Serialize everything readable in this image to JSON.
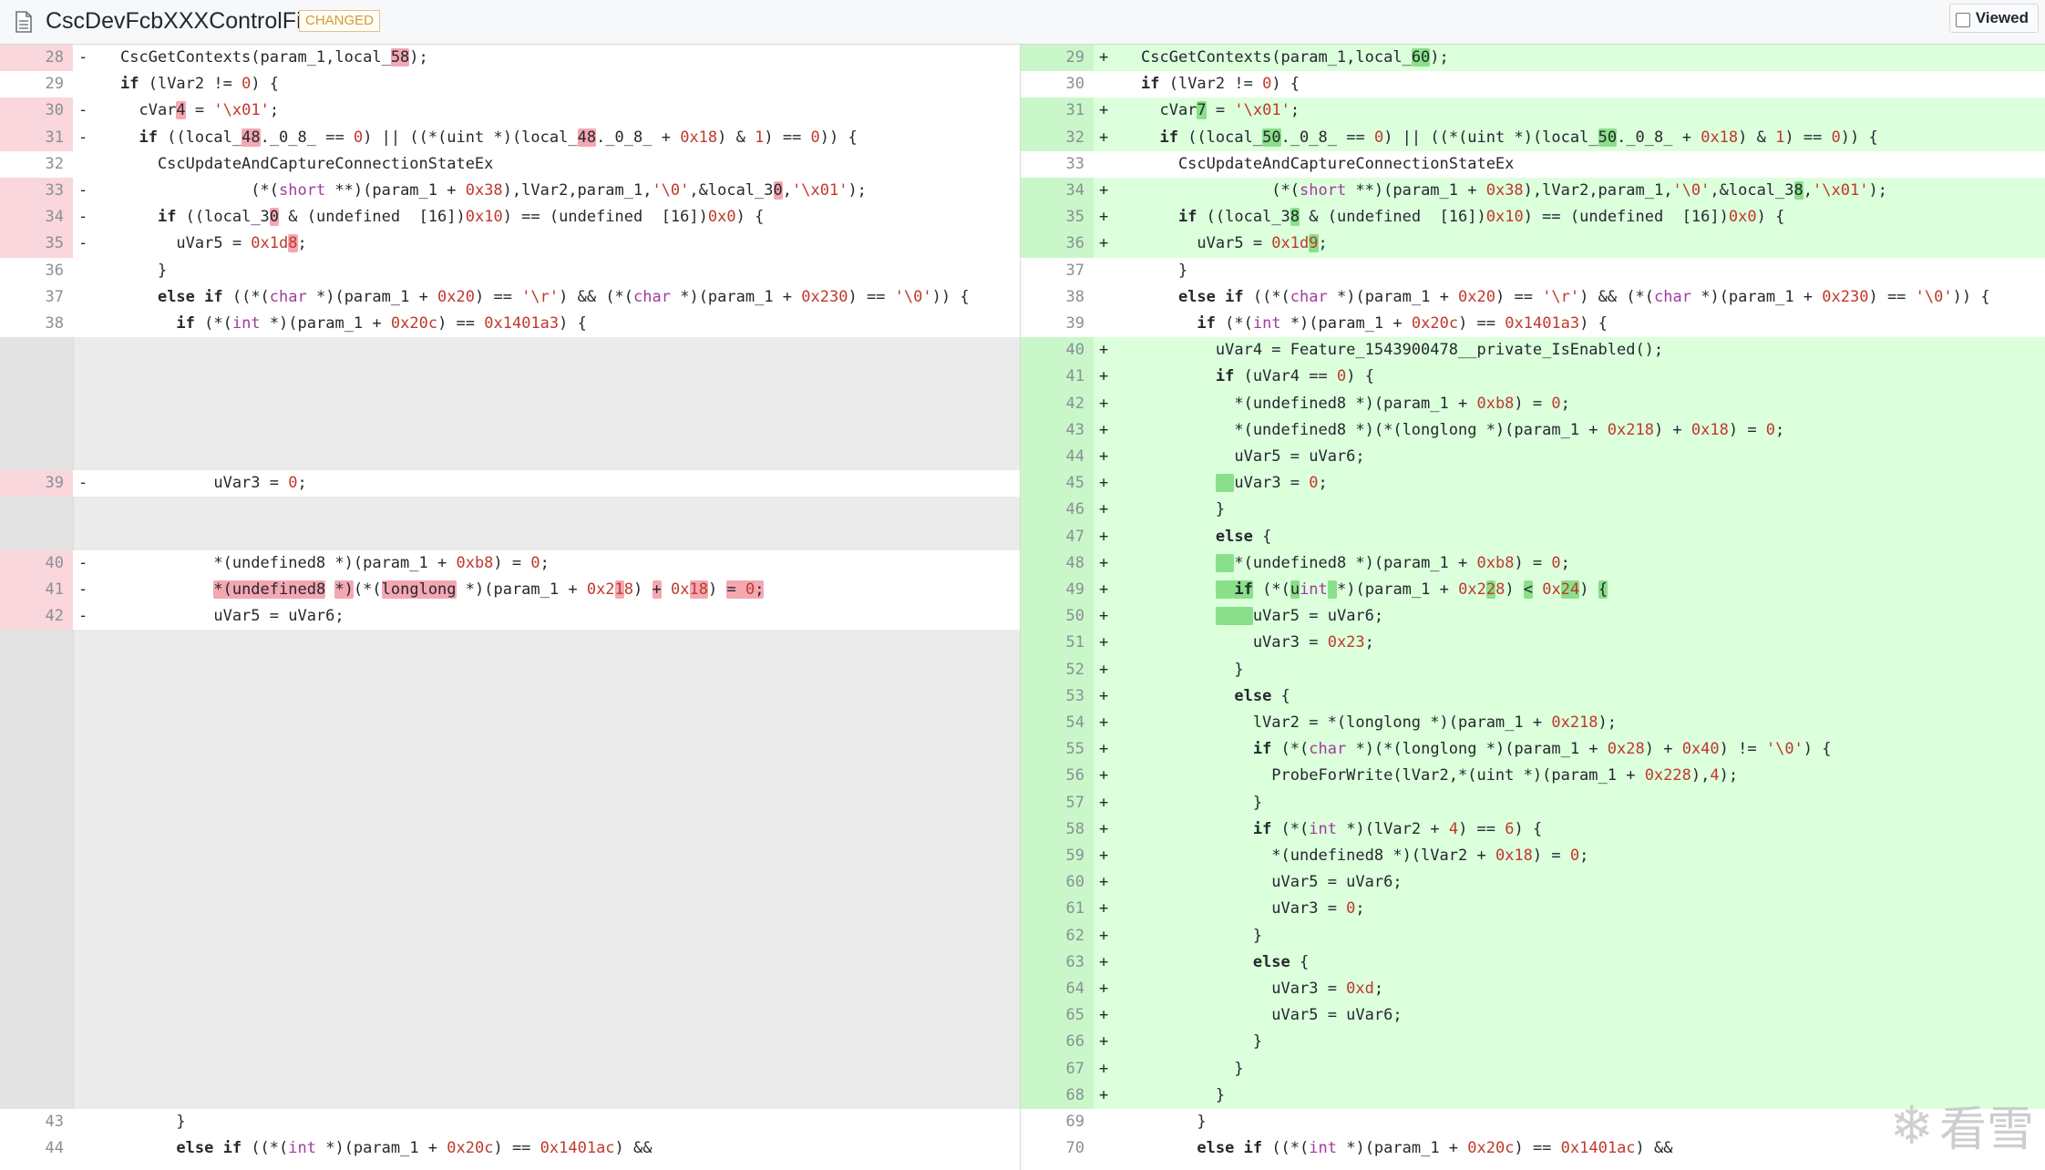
{
  "header": {
    "file_name": "CscDevFcbXXXControlFile",
    "badge": "CHANGED",
    "viewed_label": "Viewed",
    "viewed_checked": false
  },
  "watermark": {
    "text": "看雪",
    "icon": "snowflake-icon"
  },
  "colors": {
    "deleted_gutter": "#f9d7dc",
    "deleted_highlight": "#f5a7b2",
    "added_gutter": "#c9f7c9",
    "added_background": "#dcffdc",
    "added_highlight": "#8ae08a",
    "empty_background": "#ebebeb"
  },
  "left": [
    {
      "n": "28",
      "sign": "-",
      "type": "del",
      "html": "CscGetContexts(param_1,local_<span class='hd'>58</span>);"
    },
    {
      "n": "29",
      "sign": "",
      "type": "ctx",
      "html": "<span class='k'>if</span> (lVar2 != <span class='h'>0</span>) {"
    },
    {
      "n": "30",
      "sign": "-",
      "type": "del",
      "html": "  cVar<span class='hd'>4</span> = <span class='s'>'\\x01'</span>;"
    },
    {
      "n": "31",
      "sign": "-",
      "type": "del",
      "html": "  <span class='k'>if</span> ((local_<span class='hd'>48</span>._0_8_ == <span class='h'>0</span>) || ((*(uint *)(local_<span class='hd'>48</span>._0_8_ + <span class='h'>0x18</span>) &amp; <span class='h'>1</span>) == <span class='h'>0</span>)) {"
    },
    {
      "n": "32",
      "sign": "",
      "type": "ctx",
      "html": "    CscUpdateAndCaptureConnectionStateEx"
    },
    {
      "n": "33",
      "sign": "-",
      "type": "del",
      "html": "              (*(<span class='t'>short</span> **)(param_1 + <span class='h'>0x38</span>),lVar2,param_1,<span class='s'>'\\0'</span>,&amp;local_3<span class='hd'>0</span>,<span class='s'>'\\x01'</span>);"
    },
    {
      "n": "34",
      "sign": "-",
      "type": "del",
      "html": "    <span class='k'>if</span> ((local_3<span class='hd'>0</span> &amp; (undefined  [16])<span class='h'>0x10</span>) == (undefined  [16])<span class='h'>0x0</span>) {"
    },
    {
      "n": "35",
      "sign": "-",
      "type": "del",
      "html": "      uVar5 = <span class='h'>0x1d<span class='hd'>8</span></span>;"
    },
    {
      "n": "36",
      "sign": "",
      "type": "ctx",
      "html": "    }"
    },
    {
      "n": "37",
      "sign": "",
      "type": "ctx",
      "html": "    <span class='k'>else if</span> ((*(<span class='t'>char</span> *)(param_1 + <span class='h'>0x20</span>) == <span class='s'>'\\r'</span>) &amp;&amp; (*(<span class='t'>char</span> *)(param_1 + <span class='h'>0x230</span>) == <span class='s'>'\\0'</span>)) {"
    },
    {
      "n": "38",
      "sign": "",
      "type": "ctx",
      "html": "      <span class='k'>if</span> (*(<span class='t'>int</span> *)(param_1 + <span class='h'>0x20c</span>) == <span class='h'>0x1401a3</span>) {"
    },
    {
      "n": "",
      "sign": "",
      "type": "empty",
      "html": ""
    },
    {
      "n": "",
      "sign": "",
      "type": "empty",
      "html": ""
    },
    {
      "n": "",
      "sign": "",
      "type": "empty",
      "html": ""
    },
    {
      "n": "",
      "sign": "",
      "type": "empty",
      "html": ""
    },
    {
      "n": "",
      "sign": "",
      "type": "empty",
      "html": ""
    },
    {
      "n": "39",
      "sign": "-",
      "type": "del",
      "html": "          uVar3 = <span class='h'>0</span>;"
    },
    {
      "n": "",
      "sign": "",
      "type": "empty",
      "html": ""
    },
    {
      "n": "",
      "sign": "",
      "type": "empty",
      "html": ""
    },
    {
      "n": "40",
      "sign": "-",
      "type": "del",
      "html": "          *(undefined8 *)(param_1 + <span class='h'>0xb8</span>) = <span class='h'>0</span>;"
    },
    {
      "n": "41",
      "sign": "-",
      "type": "del",
      "html": "          <span class='hd'>*(undefined8</span> <span class='hd'>*)</span>(*(<span class='hd'>longlong</span> *)(param_1 + <span class='h'>0x2<span class='hd'>1</span>8</span>) <span class='hd'>+</span> <span class='h'>0x<span class='hd'>18</span></span>) <span class='hd'>= <span class='h'>0</span>;</span>"
    },
    {
      "n": "42",
      "sign": "-",
      "type": "del",
      "html": "          uVar5 = uVar6;"
    },
    {
      "n": "",
      "sign": "",
      "type": "empty",
      "html": ""
    },
    {
      "n": "",
      "sign": "",
      "type": "empty",
      "html": ""
    },
    {
      "n": "",
      "sign": "",
      "type": "empty",
      "html": ""
    },
    {
      "n": "",
      "sign": "",
      "type": "empty",
      "html": ""
    },
    {
      "n": "",
      "sign": "",
      "type": "empty",
      "html": ""
    },
    {
      "n": "",
      "sign": "",
      "type": "empty",
      "html": ""
    },
    {
      "n": "",
      "sign": "",
      "type": "empty",
      "html": ""
    },
    {
      "n": "",
      "sign": "",
      "type": "empty",
      "html": ""
    },
    {
      "n": "",
      "sign": "",
      "type": "empty",
      "html": ""
    },
    {
      "n": "",
      "sign": "",
      "type": "empty",
      "html": ""
    },
    {
      "n": "",
      "sign": "",
      "type": "empty",
      "html": ""
    },
    {
      "n": "",
      "sign": "",
      "type": "empty",
      "html": ""
    },
    {
      "n": "",
      "sign": "",
      "type": "empty",
      "html": ""
    },
    {
      "n": "",
      "sign": "",
      "type": "empty",
      "html": ""
    },
    {
      "n": "",
      "sign": "",
      "type": "empty",
      "html": ""
    },
    {
      "n": "",
      "sign": "",
      "type": "empty",
      "html": ""
    },
    {
      "n": "",
      "sign": "",
      "type": "empty",
      "html": ""
    },
    {
      "n": "",
      "sign": "",
      "type": "empty",
      "html": ""
    },
    {
      "n": "43",
      "sign": "",
      "type": "ctx",
      "html": "      }"
    },
    {
      "n": "44",
      "sign": "",
      "type": "ctx",
      "html": "      <span class='k'>else if</span> ((*(<span class='t'>int</span> *)(param_1 + <span class='h'>0x20c</span>) == <span class='h'>0x1401ac</span>) &amp;&amp;"
    }
  ],
  "right": [
    {
      "n": "29",
      "sign": "+",
      "type": "add",
      "html": "CscGetContexts(param_1,local_<span class='ha'>60</span>);"
    },
    {
      "n": "30",
      "sign": "",
      "type": "ctx",
      "html": "<span class='k'>if</span> (lVar2 != <span class='h'>0</span>) {"
    },
    {
      "n": "31",
      "sign": "+",
      "type": "add",
      "html": "  cVar<span class='ha'>7</span> = <span class='s'>'\\x01'</span>;"
    },
    {
      "n": "32",
      "sign": "+",
      "type": "add",
      "html": "  <span class='k'>if</span> ((local_<span class='ha'>50</span>._0_8_ == <span class='h'>0</span>) || ((*(uint *)(local_<span class='ha'>50</span>._0_8_ + <span class='h'>0x18</span>) &amp; <span class='h'>1</span>) == <span class='h'>0</span>)) {"
    },
    {
      "n": "33",
      "sign": "",
      "type": "ctx",
      "html": "    CscUpdateAndCaptureConnectionStateEx"
    },
    {
      "n": "34",
      "sign": "+",
      "type": "add",
      "html": "              (*(<span class='t'>short</span> **)(param_1 + <span class='h'>0x38</span>),lVar2,param_1,<span class='s'>'\\0'</span>,&amp;local_3<span class='ha'>8</span>,<span class='s'>'\\x01'</span>);"
    },
    {
      "n": "35",
      "sign": "+",
      "type": "add",
      "html": "    <span class='k'>if</span> ((local_3<span class='ha'>8</span> &amp; (undefined  [16])<span class='h'>0x10</span>) == (undefined  [16])<span class='h'>0x0</span>) {"
    },
    {
      "n": "36",
      "sign": "+",
      "type": "add",
      "html": "      uVar5 = <span class='h'>0x1d<span class='ha'>9</span></span>;"
    },
    {
      "n": "37",
      "sign": "",
      "type": "ctx",
      "html": "    }"
    },
    {
      "n": "38",
      "sign": "",
      "type": "ctx",
      "html": "    <span class='k'>else if</span> ((*(<span class='t'>char</span> *)(param_1 + <span class='h'>0x20</span>) == <span class='s'>'\\r'</span>) &amp;&amp; (*(<span class='t'>char</span> *)(param_1 + <span class='h'>0x230</span>) == <span class='s'>'\\0'</span>)) {"
    },
    {
      "n": "39",
      "sign": "",
      "type": "ctx",
      "html": "      <span class='k'>if</span> (*(<span class='t'>int</span> *)(param_1 + <span class='h'>0x20c</span>) == <span class='h'>0x1401a3</span>) {"
    },
    {
      "n": "40",
      "sign": "+",
      "type": "add",
      "html": "        uVar4 = Feature_1543900478__private_IsEnabled();"
    },
    {
      "n": "41",
      "sign": "+",
      "type": "add",
      "html": "        <span class='k'>if</span> (uVar4 == <span class='h'>0</span>) {"
    },
    {
      "n": "42",
      "sign": "+",
      "type": "add",
      "html": "          *(undefined8 *)(param_1 + <span class='h'>0xb8</span>) = <span class='h'>0</span>;"
    },
    {
      "n": "43",
      "sign": "+",
      "type": "add",
      "html": "          *(undefined8 *)(*(longlong *)(param_1 + <span class='h'>0x218</span>) + <span class='h'>0x18</span>) = <span class='h'>0</span>;"
    },
    {
      "n": "44",
      "sign": "+",
      "type": "add",
      "html": "          uVar5 = uVar6;"
    },
    {
      "n": "45",
      "sign": "+",
      "type": "add",
      "html": "        <span class='ha'>  </span>uVar3 = <span class='h'>0</span>;"
    },
    {
      "n": "46",
      "sign": "+",
      "type": "add",
      "html": "        }"
    },
    {
      "n": "47",
      "sign": "+",
      "type": "add",
      "html": "        <span class='k'>else</span> {"
    },
    {
      "n": "48",
      "sign": "+",
      "type": "add",
      "html": "        <span class='ha'>  </span>*(undefined8 *)(param_1 + <span class='h'>0xb8</span>) = <span class='h'>0</span>;"
    },
    {
      "n": "49",
      "sign": "+",
      "type": "add",
      "html": "        <span class='ha'>  <span class='k'>if</span></span> (*(<span class='ha'>u</span><span class='t'>int</span><span class='ha'> </span>*)(param_1 + <span class='h'>0x2<span class='ha'>2</span>8</span>) <span class='ha'>&lt;</span> <span class='h'>0x<span class='ha'>24</span></span>) <span class='ha'>{</span>"
    },
    {
      "n": "50",
      "sign": "+",
      "type": "add",
      "html": "        <span class='ha'>    </span>uVar5 = uVar6;"
    },
    {
      "n": "51",
      "sign": "+",
      "type": "add",
      "html": "            uVar3 = <span class='h'>0x23</span>;"
    },
    {
      "n": "52",
      "sign": "+",
      "type": "add",
      "html": "          }"
    },
    {
      "n": "53",
      "sign": "+",
      "type": "add",
      "html": "          <span class='k'>else</span> {"
    },
    {
      "n": "54",
      "sign": "+",
      "type": "add",
      "html": "            lVar2 = *(longlong *)(param_1 + <span class='h'>0x218</span>);"
    },
    {
      "n": "55",
      "sign": "+",
      "type": "add",
      "html": "            <span class='k'>if</span> (*(<span class='t'>char</span> *)(*(longlong *)(param_1 + <span class='h'>0x28</span>) + <span class='h'>0x40</span>) != <span class='s'>'\\0'</span>) {"
    },
    {
      "n": "56",
      "sign": "+",
      "type": "add",
      "html": "              ProbeForWrite(lVar2,*(uint *)(param_1 + <span class='h'>0x228</span>),<span class='h'>4</span>);"
    },
    {
      "n": "57",
      "sign": "+",
      "type": "add",
      "html": "            }"
    },
    {
      "n": "58",
      "sign": "+",
      "type": "add",
      "html": "            <span class='k'>if</span> (*(<span class='t'>int</span> *)(lVar2 + <span class='h'>4</span>) == <span class='h'>6</span>) {"
    },
    {
      "n": "59",
      "sign": "+",
      "type": "add",
      "html": "              *(undefined8 *)(lVar2 + <span class='h'>0x18</span>) = <span class='h'>0</span>;"
    },
    {
      "n": "60",
      "sign": "+",
      "type": "add",
      "html": "              uVar5 = uVar6;"
    },
    {
      "n": "61",
      "sign": "+",
      "type": "add",
      "html": "              uVar3 = <span class='h'>0</span>;"
    },
    {
      "n": "62",
      "sign": "+",
      "type": "add",
      "html": "            }"
    },
    {
      "n": "63",
      "sign": "+",
      "type": "add",
      "html": "            <span class='k'>else</span> {"
    },
    {
      "n": "64",
      "sign": "+",
      "type": "add",
      "html": "              uVar3 = <span class='h'>0xd</span>;"
    },
    {
      "n": "65",
      "sign": "+",
      "type": "add",
      "html": "              uVar5 = uVar6;"
    },
    {
      "n": "66",
      "sign": "+",
      "type": "add",
      "html": "            }"
    },
    {
      "n": "67",
      "sign": "+",
      "type": "add",
      "html": "          }"
    },
    {
      "n": "68",
      "sign": "+",
      "type": "add",
      "html": "        }"
    },
    {
      "n": "69",
      "sign": "",
      "type": "ctx",
      "html": "      }"
    },
    {
      "n": "70",
      "sign": "",
      "type": "ctx",
      "html": "      <span class='k'>else if</span> ((*(<span class='t'>int</span> *)(param_1 + <span class='h'>0x20c</span>) == <span class='h'>0x1401ac</span>) &amp;&amp;"
    }
  ]
}
